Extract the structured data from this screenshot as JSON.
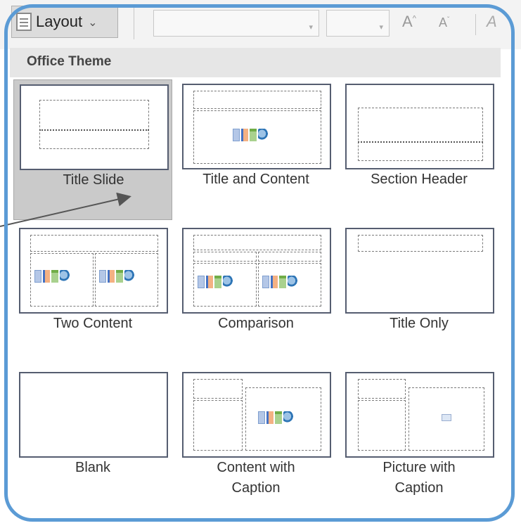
{
  "toolbar": {
    "layout_label": "Layout",
    "layout_chevron": "⌄",
    "grow_font": "A",
    "shrink_font": "A",
    "clear_format": "A"
  },
  "gallery": {
    "theme_name": "Office Theme",
    "layouts": [
      {
        "label": "Title Slide",
        "selected": true
      },
      {
        "label": "Title and Content",
        "selected": false
      },
      {
        "label": "Section Header",
        "selected": false
      },
      {
        "label": "Two Content",
        "selected": false
      },
      {
        "label": "Comparison",
        "selected": false
      },
      {
        "label": "Title Only",
        "selected": false
      },
      {
        "label": "Blank",
        "selected": false
      },
      {
        "label": "Content with Caption",
        "selected": false
      },
      {
        "label": "Picture with Caption",
        "selected": false
      }
    ]
  },
  "colors": {
    "frame": "#5b9bd5",
    "selection": "#cacaca",
    "header": "#e6e6e6"
  }
}
